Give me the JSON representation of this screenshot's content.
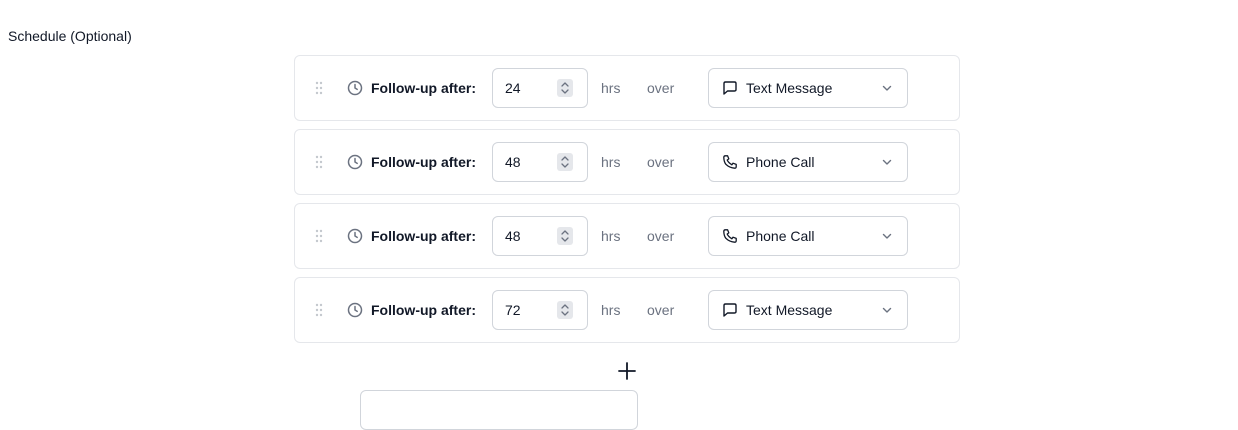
{
  "section": {
    "title": "Schedule (Optional)"
  },
  "rows": [
    {
      "label": "Follow-up after:",
      "hours": "24",
      "unit": "hrs",
      "connector": "over",
      "channel": "Text Message",
      "channel_icon": "message-square-icon"
    },
    {
      "label": "Follow-up after:",
      "hours": "48",
      "unit": "hrs",
      "connector": "over",
      "channel": "Phone Call",
      "channel_icon": "phone-icon"
    },
    {
      "label": "Follow-up after:",
      "hours": "48",
      "unit": "hrs",
      "connector": "over",
      "channel": "Phone Call",
      "channel_icon": "phone-icon"
    },
    {
      "label": "Follow-up after:",
      "hours": "72",
      "unit": "hrs",
      "connector": "over",
      "channel": "Text Message",
      "channel_icon": "message-square-icon"
    }
  ],
  "add_button": {
    "icon": "plus-icon"
  },
  "colors": {
    "border": "#e5e7eb",
    "input_border": "#d1d5db",
    "text": "#111827",
    "muted": "#6b7280",
    "icon": "#6b7280"
  }
}
